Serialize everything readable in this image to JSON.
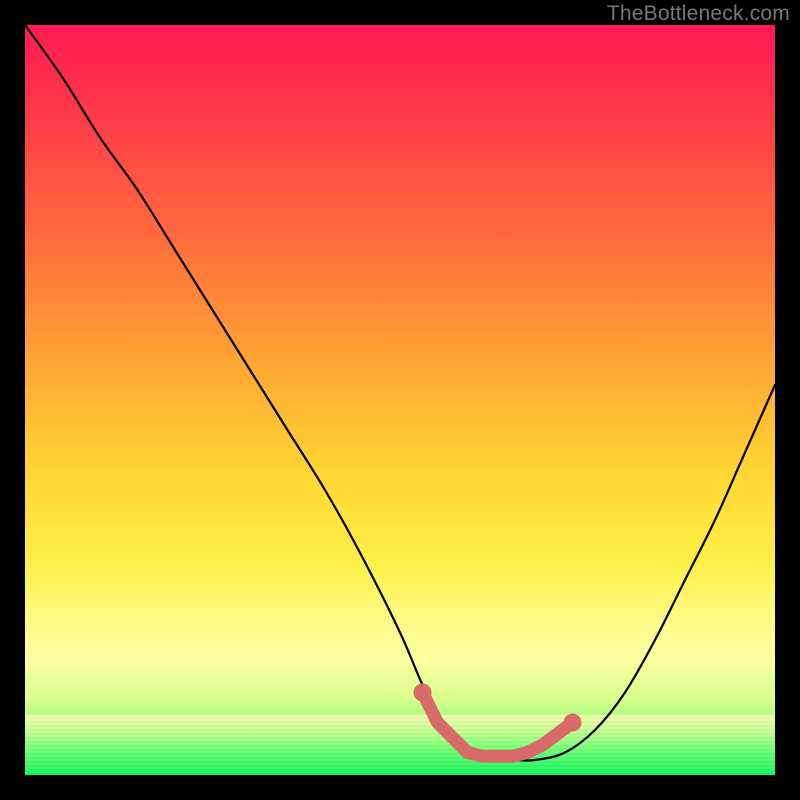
{
  "watermark": "TheBottleneck.com",
  "colors": {
    "curve_stroke": "#000000",
    "marker_fill": "#d86a6a",
    "background_black": "#000000"
  },
  "chart_data": {
    "type": "line",
    "title": "",
    "xlabel": "",
    "ylabel": "",
    "xlim": [
      0,
      100
    ],
    "ylim": [
      0,
      100
    ],
    "grid": false,
    "legend": false,
    "series": [
      {
        "name": "bottleneck-curve",
        "x": [
          0,
          5,
          10,
          15,
          20,
          25,
          30,
          35,
          40,
          45,
          50,
          53,
          56,
          59,
          62,
          65,
          68,
          72,
          76,
          80,
          84,
          88,
          92,
          96,
          100
        ],
        "y": [
          100,
          93,
          85,
          78,
          70,
          62,
          54,
          46,
          38,
          29,
          19,
          12,
          6,
          3,
          2,
          2,
          2,
          3,
          6,
          11,
          18,
          26,
          34,
          43,
          52
        ]
      }
    ],
    "markers": {
      "name": "highlight-basin",
      "x": [
        53,
        55,
        57,
        59,
        61,
        63,
        65,
        67,
        69,
        73
      ],
      "y": [
        11,
        7,
        5,
        3,
        2.5,
        2.5,
        2.5,
        3,
        4,
        7
      ],
      "r_small": 6,
      "r_large": 9
    },
    "note": "Values are estimated from pixel positions relative to the 750x750 plot area; the chart has no visible tick labels or axes."
  }
}
